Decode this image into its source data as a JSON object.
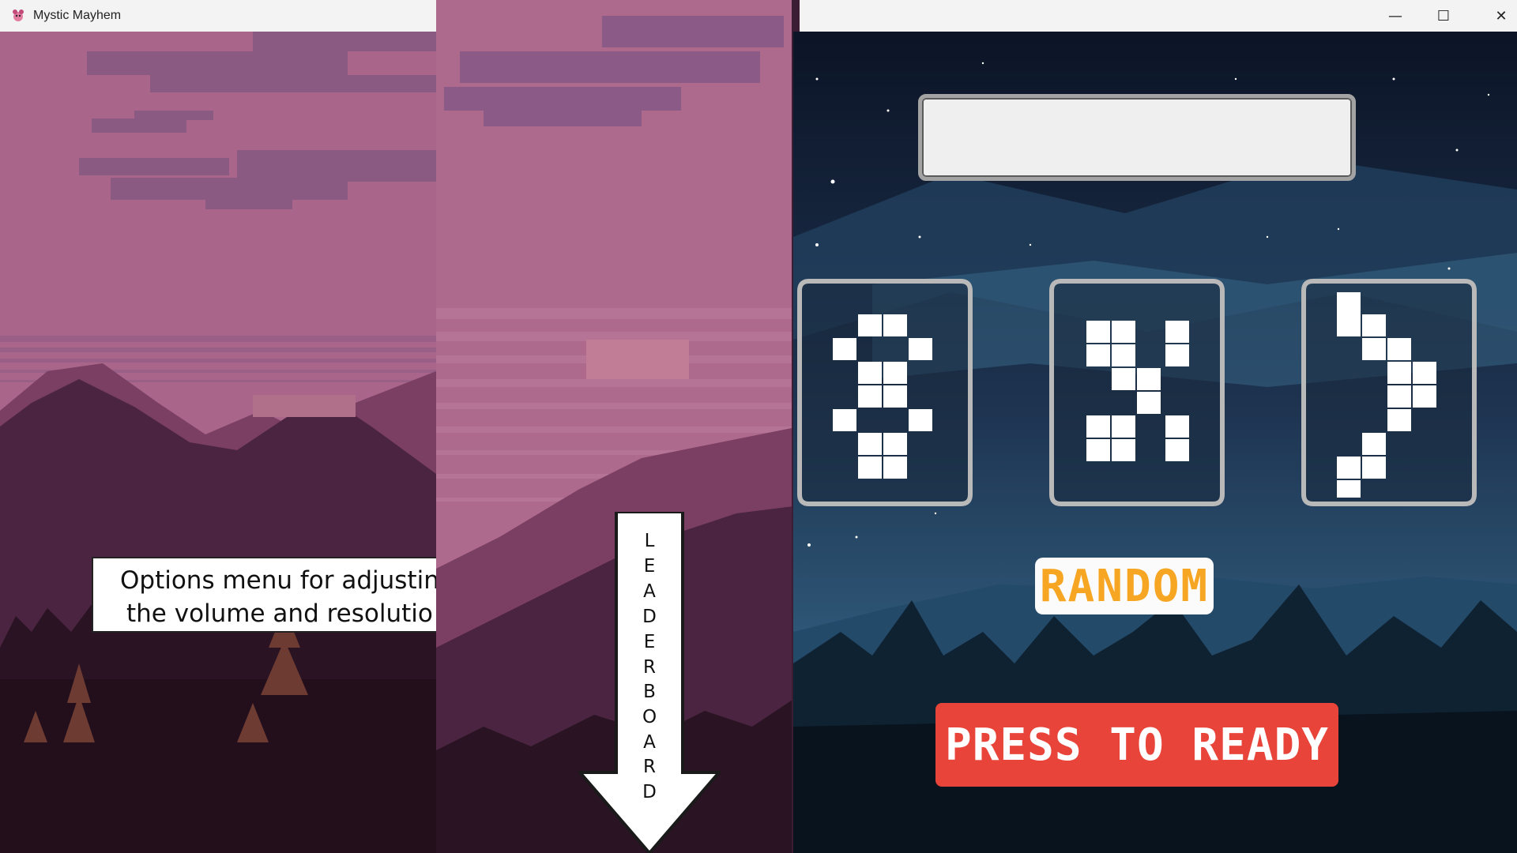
{
  "window": {
    "title": "Mystic Mayhem",
    "controls": {
      "minimize": "—",
      "maximize": "☐",
      "close": "✕"
    }
  },
  "left_panel": {
    "caption_line1": "Options menu for adjustin",
    "caption_line2": "the volume and resolutio"
  },
  "middle_panel": {
    "arrow_letters": [
      "L",
      "E",
      "A",
      "D",
      "E",
      "R",
      "B",
      "O",
      "A",
      "R",
      "D"
    ]
  },
  "right_panel": {
    "name_input_value": "",
    "random_button": "RANDOM",
    "ready_button": "PRESS TO READY",
    "character_cards": [
      "8",
      "X",
      ">"
    ]
  },
  "colors": {
    "sky_pink": "#a9668a",
    "mountain_dark": "#4a2440",
    "night_sky": "#16243d",
    "ready_red": "#e8443a",
    "random_orange": "#f6a623"
  }
}
